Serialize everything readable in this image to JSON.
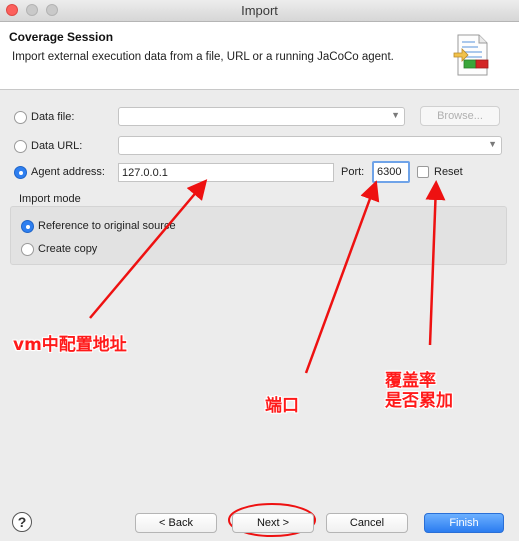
{
  "window": {
    "title": "Import"
  },
  "header": {
    "title": "Coverage Session",
    "description": "Import external execution data from a file, URL or a running JaCoCo agent."
  },
  "source": {
    "data_file_label": "Data file:",
    "data_file_value": "",
    "browse_label": "Browse...",
    "data_url_label": "Data URL:",
    "data_url_value": "",
    "agent_address_label": "Agent address:",
    "agent_address_value": "127.0.0.1",
    "port_label": "Port:",
    "port_value": "6300",
    "reset_label": "Reset",
    "reset_checked": false,
    "selected": "agent_address"
  },
  "import_mode": {
    "label": "Import mode",
    "options": [
      "Reference to original source",
      "Create copy"
    ],
    "selected": 0
  },
  "footer": {
    "back_label": "< Back",
    "next_label": "Next >",
    "cancel_label": "Cancel",
    "finish_label": "Finish"
  },
  "annotations": {
    "address": "vm中配置地址",
    "port": "端口",
    "reset_line1": "覆盖率",
    "reset_line2": "是否累加",
    "color": "#ff1a1a"
  },
  "colors": {
    "accent": "#2e7ff0",
    "close_button": "#fc605c"
  },
  "icons": [
    "help-icon",
    "chevron-down-icon",
    "wizard-import-icon"
  ]
}
